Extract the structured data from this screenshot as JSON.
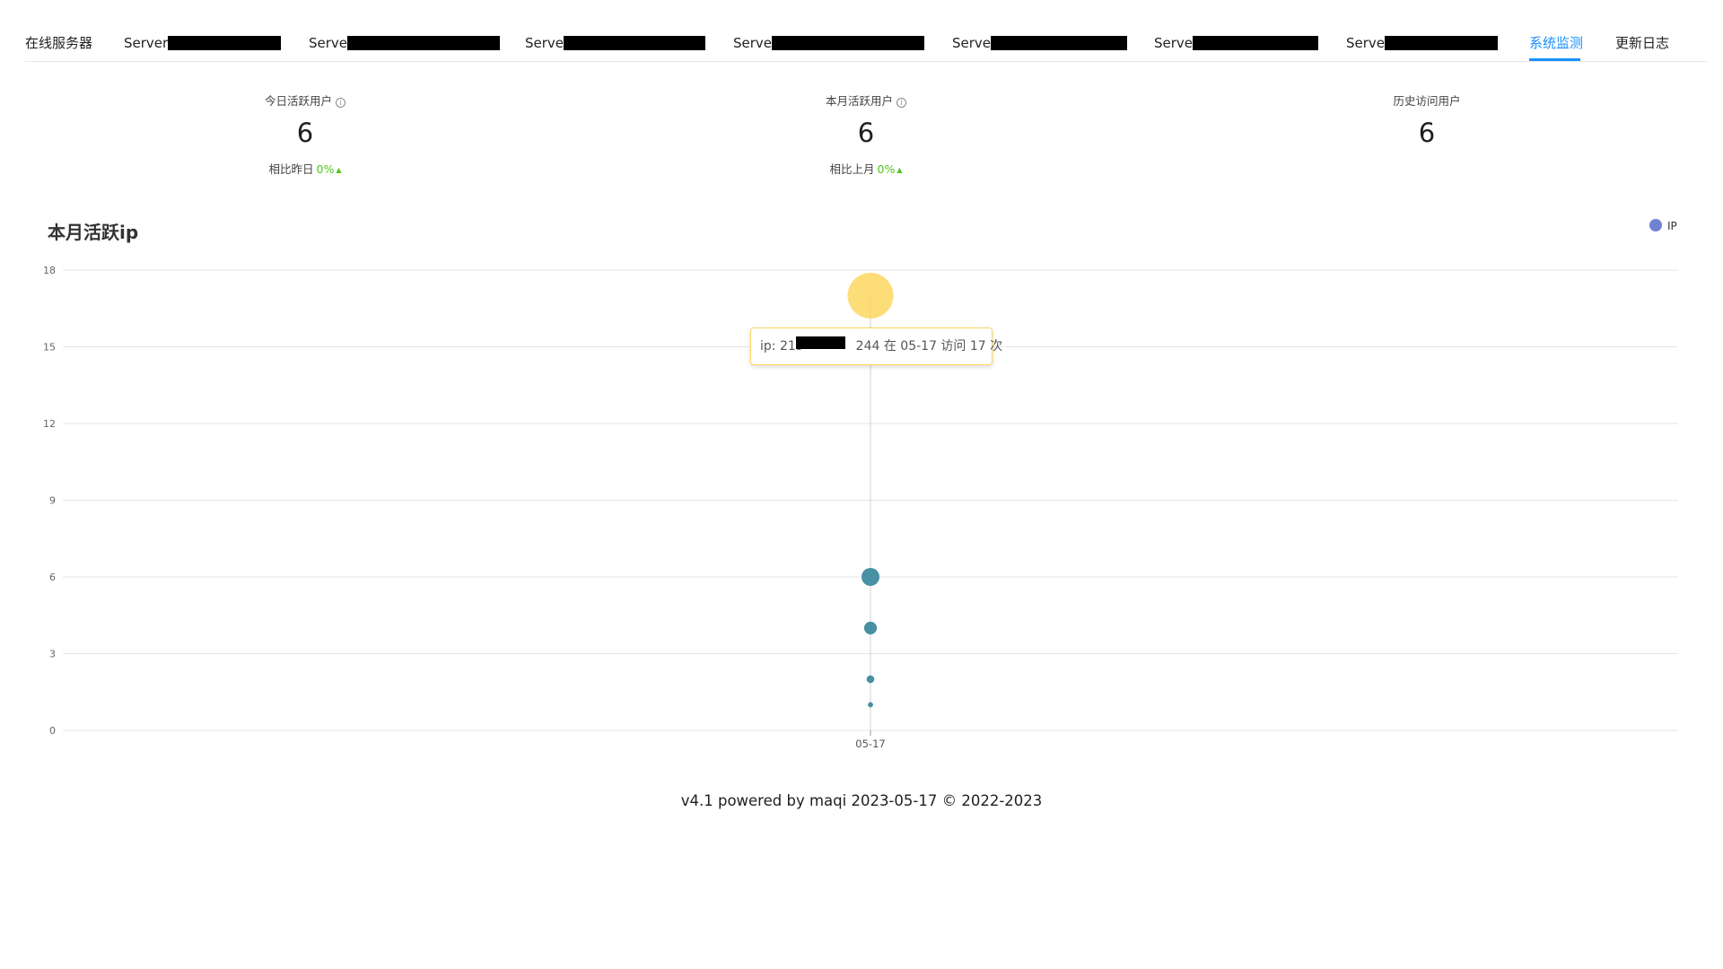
{
  "tabs": [
    {
      "label": "在线服务器",
      "left": 28,
      "redact": 0
    },
    {
      "label": "Server",
      "left": 138,
      "redact": 126
    },
    {
      "label": "Serve",
      "left": 344,
      "redact": 170
    },
    {
      "label": "Serve",
      "left": 585,
      "redact": 158
    },
    {
      "label": "Serve",
      "left": 817,
      "redact": 170
    },
    {
      "label": "Serve",
      "left": 1061,
      "redact": 152
    },
    {
      "label": "Serve",
      "left": 1286,
      "redact": 140
    },
    {
      "label": "Serve",
      "left": 1500,
      "redact": 126
    },
    {
      "label": "系统监测",
      "left": 1704,
      "redact": 0,
      "active": true
    },
    {
      "label": "更新日志",
      "left": 1800,
      "redact": 0
    }
  ],
  "stats": [
    {
      "title": "今日活跃用户",
      "has_info": true,
      "value": "6",
      "compare_label": "相比昨日",
      "compare_pct": "0%",
      "trend": "up"
    },
    {
      "title": "本月活跃用户",
      "has_info": true,
      "value": "6",
      "compare_label": "相比上月",
      "compare_pct": "0%",
      "trend": "up"
    },
    {
      "title": "历史访问用户",
      "has_info": false,
      "value": "6"
    }
  ],
  "chart": {
    "title": "本月活跃ip",
    "legend": {
      "label": "IP",
      "color": "#7082d4"
    },
    "tooltip": {
      "prefix": "ip: 219",
      "suffix": "244 在 05-17 访问 17 次"
    }
  },
  "chart_data": {
    "type": "scatter",
    "title": "本月活跃ip",
    "categories": [
      "05-17"
    ],
    "y_ticks": [
      0,
      3,
      6,
      9,
      12,
      15,
      18
    ],
    "ylim": [
      0,
      18
    ],
    "grid": true,
    "legend_position": "top-right",
    "series": [
      {
        "name": "IP",
        "points": [
          {
            "x": "05-17",
            "y": 17,
            "highlighted": true
          },
          {
            "x": "05-17",
            "y": 6
          },
          {
            "x": "05-17",
            "y": 4
          },
          {
            "x": "05-17",
            "y": 2
          },
          {
            "x": "05-17",
            "y": 1
          }
        ]
      }
    ],
    "colors": {
      "point": "#3e8a9e",
      "highlight": "#fbd760",
      "axis_pointer": "#d0d0d0"
    }
  },
  "footer": {
    "text": "v4.1 powered by maqi 2023-05-17 © 2022-2023"
  }
}
